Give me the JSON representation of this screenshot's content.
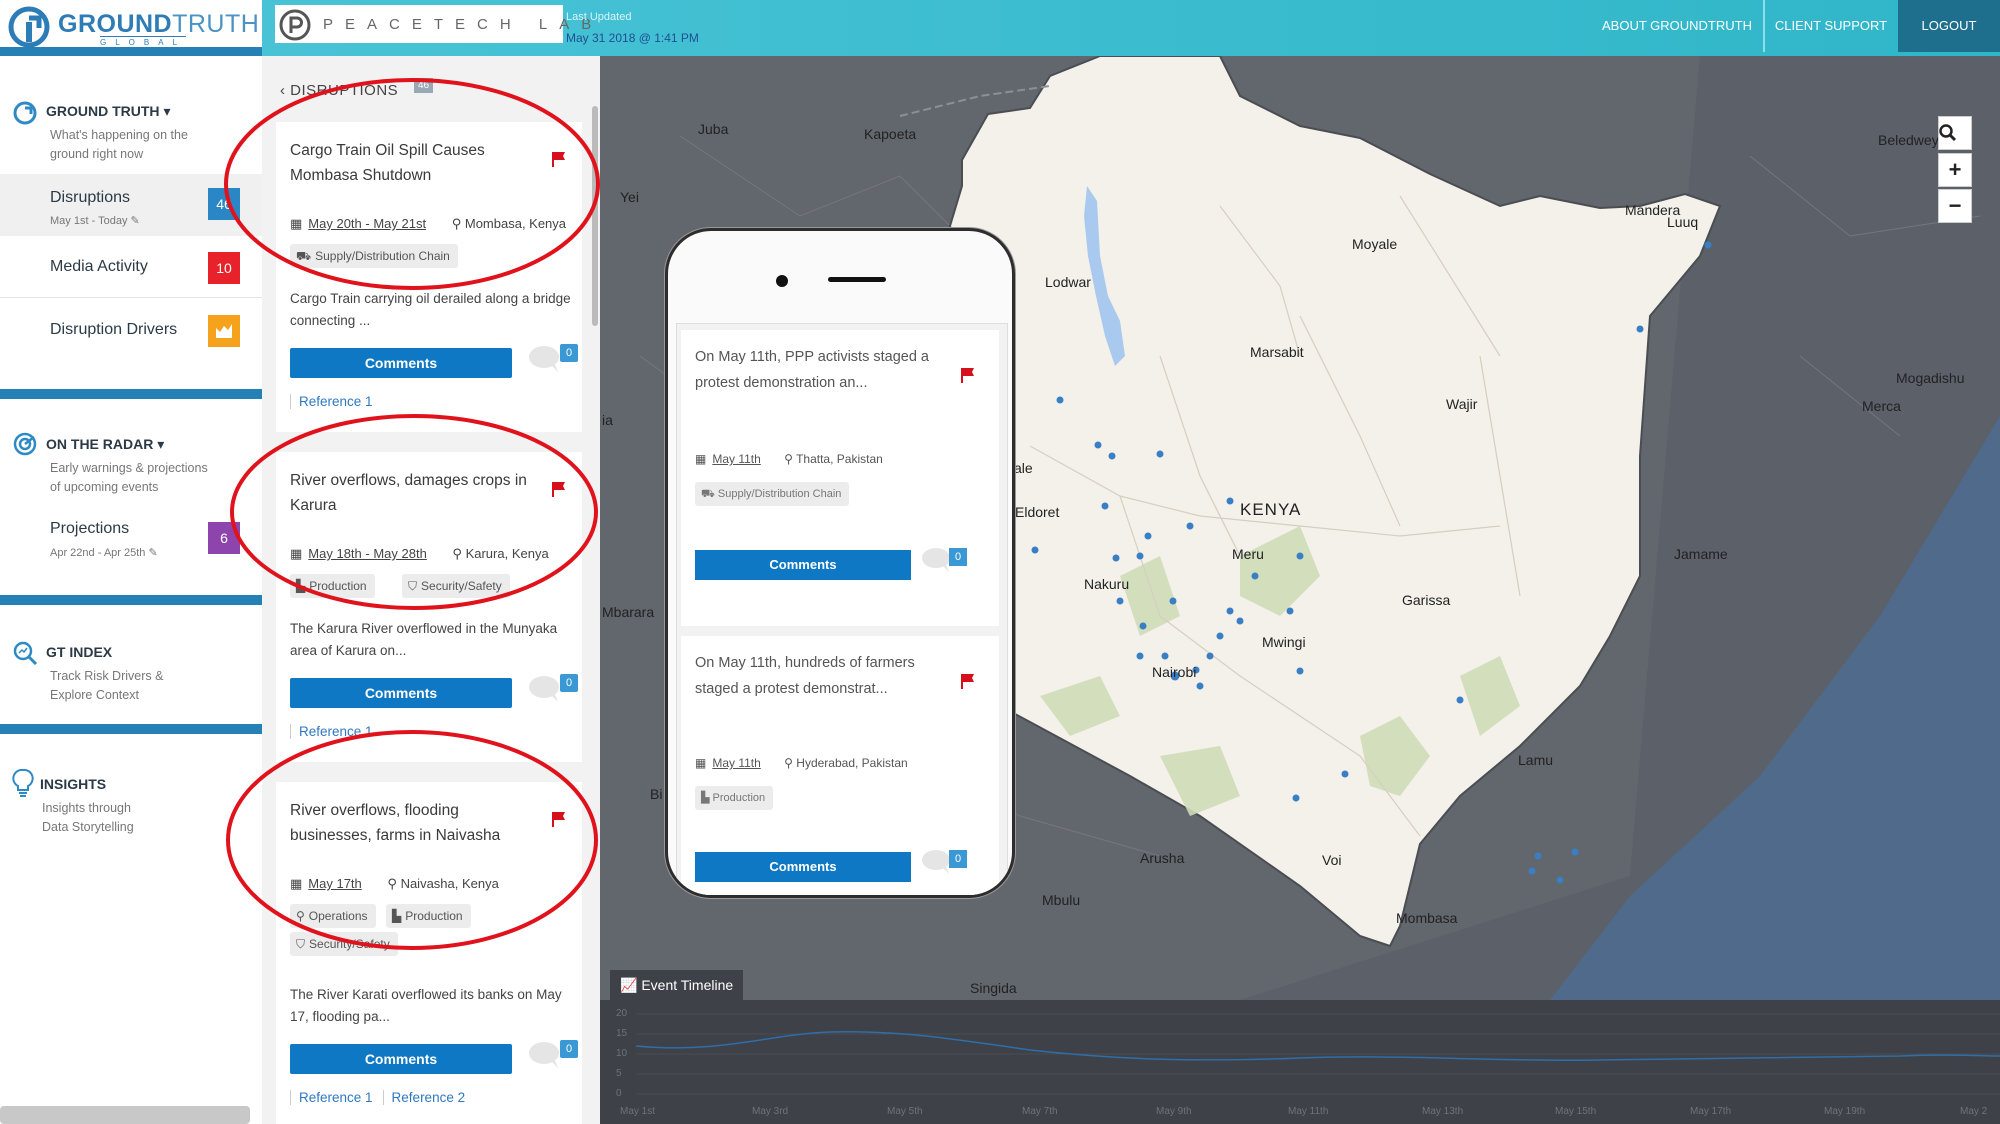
{
  "header": {
    "logo_bold": "GROUND",
    "logo_thin": "TRUTH",
    "logo_sub": "GLOBAL",
    "partner": "PEACETECH LAB",
    "last_updated_label": "Last Updated",
    "last_updated_value": "May 31 2018 @ 1:41 PM",
    "nav": {
      "about": "ABOUT GROUNDTRUTH",
      "support": "CLIENT SUPPORT",
      "logout": "LOGOUT"
    },
    "colors": {
      "brand": "#2480b5",
      "teal": "#2fb6c8",
      "logout_bg": "#1e6f8e"
    }
  },
  "sidebar": {
    "ground_truth": {
      "title": "GROUND TRUTH",
      "desc_1": "What's happening on the",
      "desc_2": "ground right now",
      "items": [
        {
          "label": "Disruptions",
          "sub": "May 1st - Today",
          "badge": "46",
          "badge_color": "#2b86c5"
        },
        {
          "label": "Media Activity",
          "badge": "10",
          "badge_color": "#e8222b"
        },
        {
          "label": "Disruption Drivers",
          "badge_icon": "bar-chart-icon",
          "badge_color": "#f5a31c"
        }
      ]
    },
    "on_the_radar": {
      "title": "ON THE RADAR",
      "desc_1": "Early warnings & projections",
      "desc_2": "of upcoming events",
      "items": [
        {
          "label": "Projections",
          "sub": "Apr 22nd - Apr 25th",
          "badge": "6",
          "badge_color": "#8e44ad"
        }
      ]
    },
    "gt_index": {
      "title": "GT INDEX",
      "desc_1": "Track Risk Drivers &",
      "desc_2": "Explore Context"
    },
    "insights": {
      "title": "INSIGHTS",
      "desc_1": "Insights through",
      "desc_2": "Data Storytelling"
    }
  },
  "feed": {
    "heading": "DISRUPTIONS",
    "count": "46",
    "cards": [
      {
        "title": "Cargo Train Oil Spill Causes Mombasa Shutdown",
        "date": "May 20th - May 21st",
        "location": "Mombasa, Kenya",
        "tags": [
          {
            "icon": "truck-icon",
            "label": "Supply/Distribution Chain"
          }
        ],
        "body": "Cargo Train carrying oil derailed along a bridge connecting ...",
        "comments_label": "Comments",
        "comment_count": "0",
        "refs": [
          "Reference 1"
        ]
      },
      {
        "title": "River overflows, damages crops in Karura",
        "date": "May 18th - May 28th",
        "location": "Karura, Kenya",
        "tags": [
          {
            "icon": "factory-icon",
            "label": "Production"
          },
          {
            "icon": "shield-icon",
            "label": "Security/Safety"
          }
        ],
        "body": "The Karura River overflowed in the Munyaka area of Karura on...",
        "comments_label": "Comments",
        "comment_count": "0",
        "refs": [
          "Reference 1"
        ]
      },
      {
        "title": "River overflows, flooding businesses, farms in Naivasha",
        "date": "May 17th",
        "location": "Naivasha, Kenya",
        "tags": [
          {
            "icon": "search-icon",
            "label": "Operations"
          },
          {
            "icon": "factory-icon",
            "label": "Production"
          },
          {
            "icon": "shield-icon",
            "label": "Security/Safety"
          }
        ],
        "body": "The River Karati overflowed its banks on May 17, flooding pa...",
        "comments_label": "Comments",
        "comment_count": "0",
        "refs": [
          "Reference 1",
          "Reference 2"
        ]
      }
    ]
  },
  "map": {
    "country": "KENYA",
    "labels": [
      "Juba",
      "Kapoeta",
      "Yei",
      "Lodwar",
      "Moyale",
      "Mandera",
      "Luuq",
      "Beledweyne",
      "Marsabit",
      "Wajir",
      "Mogadishu",
      "Merca",
      "ale",
      "Eldoret",
      "Nakuru",
      "Meru",
      "Mwingi",
      "Nairobi",
      "Garissa",
      "Jamame",
      "Mbarara",
      "Lamu",
      "Arusha",
      "Voi",
      "Mbulu",
      "Mombasa",
      "Singida",
      "ia",
      "Bi"
    ],
    "zoom": {
      "search": "search-icon",
      "in": "+",
      "out": "−"
    }
  },
  "timeline": {
    "tab": "Event Timeline",
    "y_ticks": [
      "20",
      "15",
      "10",
      "5",
      "0"
    ],
    "x_ticks": [
      "May 1st",
      "May 3rd",
      "May 5th",
      "May 7th",
      "May 9th",
      "May 11th",
      "May 13th",
      "May 15th",
      "May 17th",
      "May 19th",
      "May 2"
    ]
  },
  "phone": {
    "cards": [
      {
        "title": "On May 11th, PPP activists staged a protest demonstration an...",
        "date": "May 11th",
        "location": "Thatta, Pakistan",
        "tag": "Supply/Distribution Chain",
        "tag_icon": "truck-icon",
        "comments_label": "Comments",
        "comment_count": "0"
      },
      {
        "title": "On May 11th, hundreds of farmers staged a protest demonstrat...",
        "date": "May 11th",
        "location": "Hyderabad, Pakistan",
        "tag": "Production",
        "tag_icon": "factory-icon",
        "comments_label": "Comments",
        "comment_count": "0"
      }
    ]
  }
}
